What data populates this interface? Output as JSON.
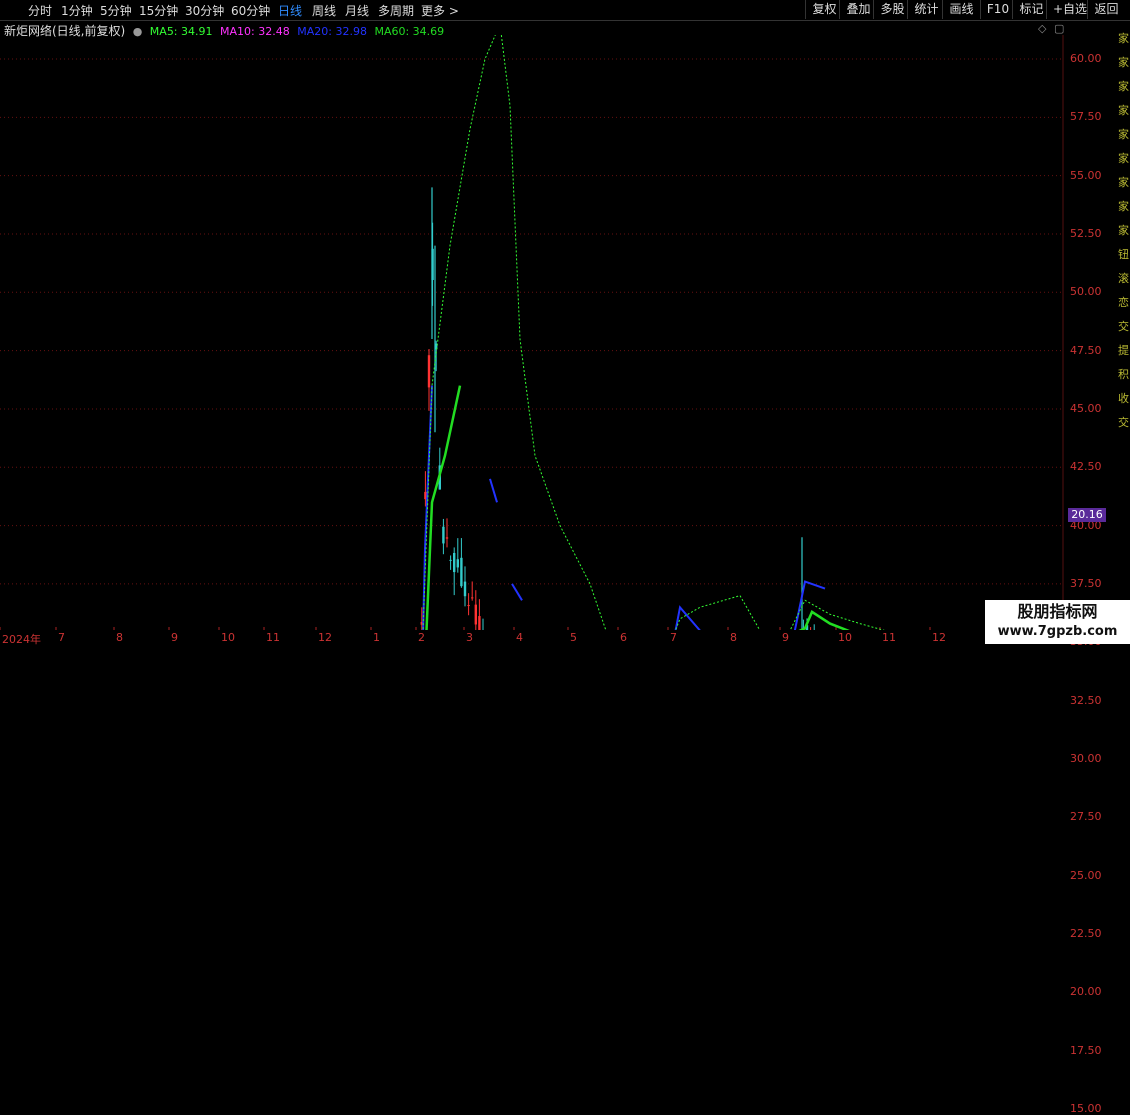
{
  "toolbar": {
    "periods": [
      "分时",
      "1分钟",
      "5分钟",
      "15分钟",
      "30分钟",
      "60分钟",
      "日线",
      "周线",
      "月线",
      "多周期",
      "更多 >"
    ],
    "active_period": "日线",
    "right_buttons": [
      "复权",
      "叠加",
      "多股",
      "统计",
      "画线",
      "F10",
      "标记",
      "+自选",
      "返回"
    ]
  },
  "legend": {
    "stock": "新炬网络(日线,前复权)",
    "ma5": "MA5: 34.91",
    "ma10": "MA10: 32.48",
    "ma20": "MA20: 32.98",
    "ma60": "MA60: 34.69"
  },
  "corner_icons": [
    "diamond-icon",
    "window-icon"
  ],
  "current_price": "20.16",
  "side_glyphs": [
    "家",
    "家",
    "家",
    "家",
    "家",
    "家",
    "家",
    "家",
    "家",
    "钮",
    "滚",
    "恋",
    "交",
    "提",
    "积",
    "收",
    "交"
  ],
  "watermark": {
    "line1": "股朋指标网",
    "line2": "www.7gpzb.com"
  },
  "colors": {
    "up": "#ff3333",
    "down": "#33cccc",
    "ma5": "#33ff33",
    "ma10": "#ff33ff",
    "ma20": "#2233ff",
    "ma60": "#22dd22",
    "price_line": "#ff33ff",
    "grid": "#661111"
  },
  "chart_data": {
    "type": "candlestick",
    "title": "新炬网络(日线,前复权)",
    "ylim": [
      14,
      62
    ],
    "y_ticks": [
      "60.00",
      "57.50",
      "55.00",
      "52.50",
      "50.00",
      "47.50",
      "45.00",
      "42.50",
      "40.00",
      "37.50",
      "35.00",
      "32.50",
      "30.00",
      "27.50",
      "25.00",
      "22.50",
      "20.00",
      "17.50",
      "15.00"
    ],
    "x_ticks": [
      "2024年",
      "7",
      "8",
      "9",
      "10",
      "11",
      "12",
      "1",
      "2",
      "3",
      "4",
      "5",
      "6",
      "7",
      "8",
      "9",
      "10",
      "11",
      "12"
    ],
    "price_line": 32.48,
    "series": [
      {
        "name": "MA5",
        "values": [
          34.91
        ]
      },
      {
        "name": "MA10",
        "values": [
          32.48
        ]
      },
      {
        "name": "MA20",
        "values": [
          32.98
        ]
      },
      {
        "name": "MA60",
        "values": [
          34.69
        ]
      }
    ]
  }
}
